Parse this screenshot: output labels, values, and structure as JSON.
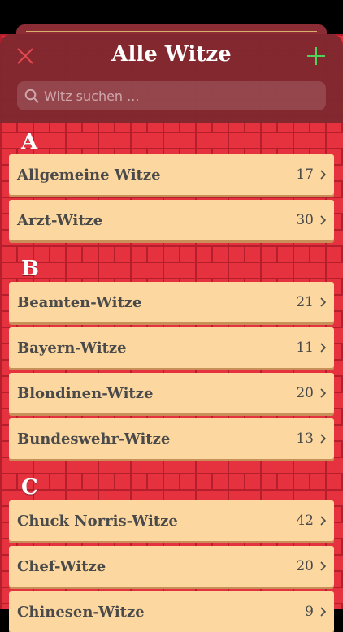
{
  "header": {
    "title": "Alle Witze",
    "close_icon": "close-icon",
    "add_icon": "plus-icon"
  },
  "search": {
    "placeholder": "Witz suchen ..."
  },
  "colors": {
    "brick_red": "#e6323f",
    "header_bg": "#802830",
    "row_bg": "#fcd8a0",
    "close_red": "#e4484f",
    "add_green": "#4fd25c"
  },
  "sections": [
    {
      "letter": "A",
      "items": [
        {
          "label": "Allgemeine Witze",
          "count": "17"
        },
        {
          "label": "Arzt-Witze",
          "count": "30"
        }
      ]
    },
    {
      "letter": "B",
      "items": [
        {
          "label": "Beamten-Witze",
          "count": "21"
        },
        {
          "label": "Bayern-Witze",
          "count": "11"
        },
        {
          "label": "Blondinen-Witze",
          "count": "20"
        },
        {
          "label": "Bundeswehr-Witze",
          "count": "13"
        }
      ]
    },
    {
      "letter": "C",
      "items": [
        {
          "label": "Chuck Norris-Witze",
          "count": "42"
        },
        {
          "label": "Chef-Witze",
          "count": "20"
        },
        {
          "label": "Chinesen-Witze",
          "count": "9"
        }
      ]
    }
  ]
}
